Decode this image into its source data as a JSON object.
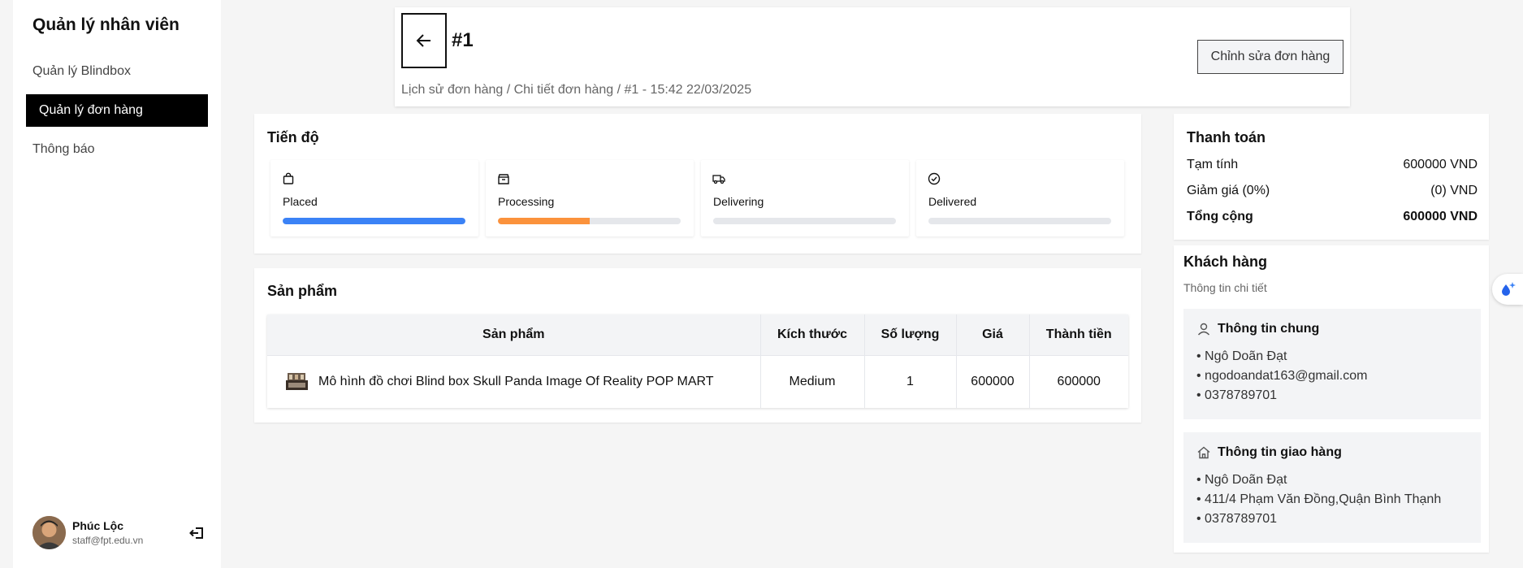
{
  "sidebar": {
    "brand": "Quản lý nhân viên",
    "items": [
      {
        "label": "Quản lý Blindbox",
        "active": false
      },
      {
        "label": "Quản lý đơn hàng",
        "active": true
      },
      {
        "label": "Thông báo",
        "active": false
      }
    ],
    "user": {
      "name": "Phúc Lộc",
      "email": "staff@fpt.edu.vn"
    }
  },
  "header": {
    "order_id": "#1",
    "edit_label": "Chỉnh sửa đơn hàng",
    "breadcrumb": "Lịch sử đơn hàng / Chi tiết đơn hàng / #1 - 15:42 22/03/2025"
  },
  "progress": {
    "title": "Tiến độ",
    "steps": [
      {
        "label": "Placed",
        "icon": "shopping-bag-icon",
        "fill": 1.0,
        "color": "#3b82f6"
      },
      {
        "label": "Processing",
        "icon": "package-icon",
        "fill": 0.5,
        "color": "#fb923c"
      },
      {
        "label": "Delivering",
        "icon": "truck-icon",
        "fill": 0.0,
        "color": "#e5e7eb"
      },
      {
        "label": "Delivered",
        "icon": "check-circle-icon",
        "fill": 0.0,
        "color": "#e5e7eb"
      }
    ]
  },
  "products": {
    "title": "Sản phẩm",
    "headers": [
      "Sản phẩm",
      "Kích thước",
      "Số lượng",
      "Giá",
      "Thành tiền"
    ],
    "rows": [
      {
        "name": "Mô hình đồ chơi Blind box Skull Panda Image Of Reality POP MART",
        "size": "Medium",
        "qty": "1",
        "price": "600000",
        "total": "600000"
      }
    ]
  },
  "payment": {
    "title": "Thanh toán",
    "subtotal_label": "Tạm tính",
    "subtotal_value": "600000 VND",
    "discount_label": "Giảm giá (0%)",
    "discount_value": "(0) VND",
    "total_label": "Tổng cộng",
    "total_value": "600000 VND"
  },
  "customer": {
    "title": "Khách hàng",
    "subtitle": "Thông tin chi tiết",
    "general": {
      "title": "Thông tin chung",
      "name": "• Ngô Doãn Đạt",
      "email": "• ngodoandat163@gmail.com",
      "phone": "• 0378789701"
    },
    "shipping": {
      "title": "Thông tin giao hàng",
      "name": "• Ngô Doãn Đạt",
      "address": "• 411/4 Phạm Văn Đồng,Quận Bình Thạnh",
      "phone": "• 0378789701"
    }
  },
  "colors": {
    "accent_blue": "#3b82f6",
    "accent_orange": "#fb923c",
    "active_nav": "#000000"
  }
}
